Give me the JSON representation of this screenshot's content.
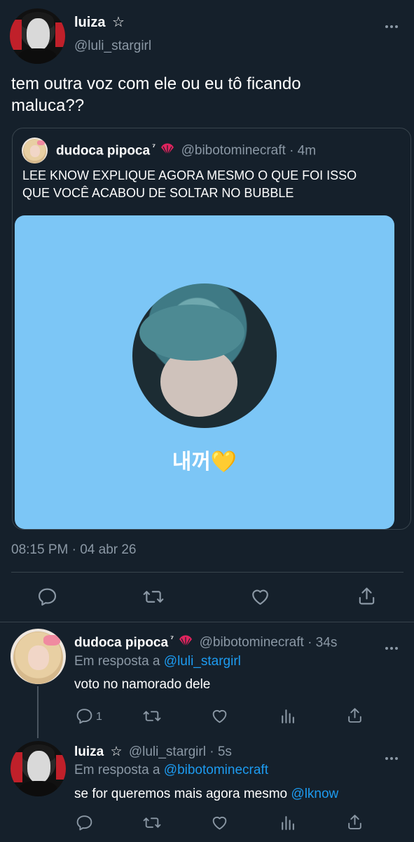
{
  "main_tweet": {
    "name": "luiza",
    "badge": "☆",
    "handle": "@luli_stargirl",
    "text_line1": "tem outra voz com ele ou eu tô ficando",
    "text_line2": "maluca??",
    "timestamp": "08:15 PM · 04 abr 26"
  },
  "quoted": {
    "name": "dudoca pipoca",
    "name_sup": "⁷",
    "handle": "@bibotominecraft",
    "time": "· 4m",
    "text_line1": "LEE KNOW EXPLIQUE AGORA MESMO O QUE FOI ISSO",
    "text_line2": "QUE VOCÊ ACABOU DE SOLTAR NO BUBBLE",
    "image_caption": "내꺼💛"
  },
  "reply1": {
    "name": "dudoca pipoca",
    "name_sup": "⁷",
    "handle": "@bibotominecraft",
    "time": "· 34s",
    "reply_prefix": "Em resposta a",
    "reply_to": "@luli_stargirl",
    "text": "voto no namorado dele",
    "reply_count": "1"
  },
  "reply2": {
    "name": "luiza",
    "badge": "☆",
    "handle": "@luli_stargirl",
    "time": "· 5s",
    "reply_prefix": "Em resposta a",
    "reply_to": "@bibotominecraft",
    "text_prefix": "se for queremos mais agora mesmo",
    "mention": "@lknow"
  },
  "colors": {
    "background": "#15202b",
    "muted": "#8b98a5",
    "link": "#1d9bf0",
    "image_bg": "#7cc6f6"
  },
  "icons": [
    "more-icon",
    "reply-icon",
    "retweet-icon",
    "like-icon",
    "share-icon",
    "analytics-icon",
    "fan-emoji-icon"
  ]
}
